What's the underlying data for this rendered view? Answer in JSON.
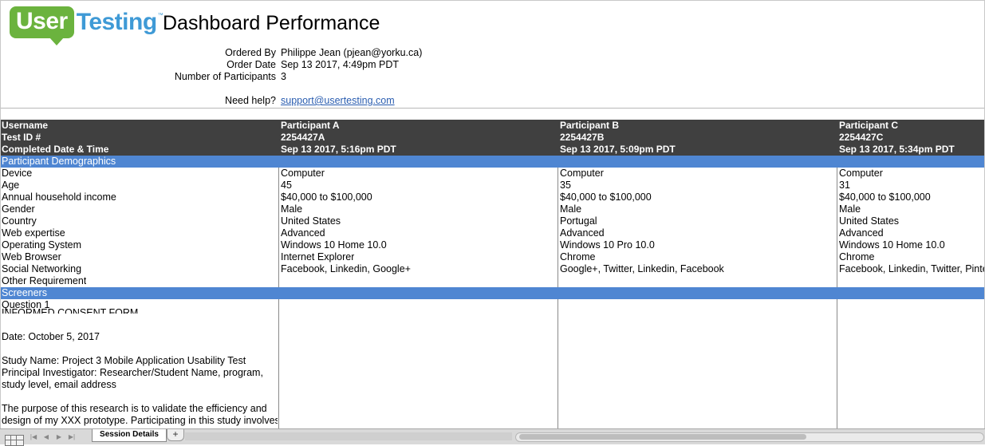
{
  "logo": {
    "part1": "User",
    "part2": "Testing",
    "tm": "™"
  },
  "report": {
    "title": "Dashboard Performance"
  },
  "meta": {
    "ordered_by_label": "Ordered By",
    "ordered_by_value": "Philippe Jean (pjean@yorku.ca)",
    "order_date_label": "Order Date",
    "order_date_value": "Sep 13 2017, 4:49pm PDT",
    "participants_label": "Number of Participants",
    "participants_value": "3",
    "help_label": "Need help?",
    "help_link": "support@usertesting.com"
  },
  "header": {
    "labels": [
      "Username",
      "Test ID #",
      "Completed Date & Time"
    ],
    "participants": [
      {
        "username": "Participant A",
        "test_id": "2254427A",
        "completed": "Sep 13 2017, 5:16pm PDT"
      },
      {
        "username": "Participant B",
        "test_id": "2254427B",
        "completed": "Sep 13 2017, 5:09pm PDT"
      },
      {
        "username": "Participant C",
        "test_id": "2254427C",
        "completed": "Sep 13 2017, 5:34pm PDT"
      }
    ]
  },
  "demographics": {
    "section_title": "Participant Demographics",
    "row_labels": [
      "Device",
      "Age",
      "Annual household income",
      "Gender",
      "Country",
      "Web expertise",
      "Operating System",
      "Web Browser",
      "Social Networking",
      "Other Requirement"
    ],
    "values": [
      [
        "Computer",
        "45",
        "$40,000 to $100,000",
        "Male",
        "United States",
        "Advanced",
        "Windows 10 Home 10.0",
        "Internet Explorer",
        "Facebook, Linkedin, Google+",
        ""
      ],
      [
        "Computer",
        "35",
        "$40,000 to $100,000",
        "Male",
        "Portugal",
        "Advanced",
        "Windows 10 Pro 10.0",
        "Chrome",
        "Google+, Twitter, Linkedin, Facebook",
        ""
      ],
      [
        "Computer",
        "31",
        "$40,000 to $100,000",
        "Male",
        "United States",
        "Advanced",
        "Windows 10 Home 10.0",
        "Chrome",
        "Facebook, Linkedin, Twitter, Pinter",
        ""
      ]
    ]
  },
  "screeners": {
    "section_title": "Screeners",
    "question_label": "Question 1",
    "question_lines": [
      "INFORMED CONSENT FORM",
      "",
      "Date: October 5, 2017",
      "",
      "Study Name: Project 3 Mobile Application Usability Test",
      "Principal Investigator: Researcher/Student Name, program,",
      "study level, email address",
      "",
      "The purpose of this research is to validate the efficiency and",
      "design of my XXX prototype. Participating in this study involves a"
    ]
  },
  "sheet_tabs": {
    "active": "Session Details",
    "add": "+"
  },
  "nav_icons": [
    "first-sheet-icon",
    "prev-sheet-icon",
    "next-sheet-icon",
    "last-sheet-icon"
  ],
  "colors": {
    "dark_band": "#404040",
    "blue_band": "#4f86d2",
    "logo_green": "#6bb33e",
    "logo_blue": "#3f9ad6",
    "link": "#2a5db0"
  }
}
